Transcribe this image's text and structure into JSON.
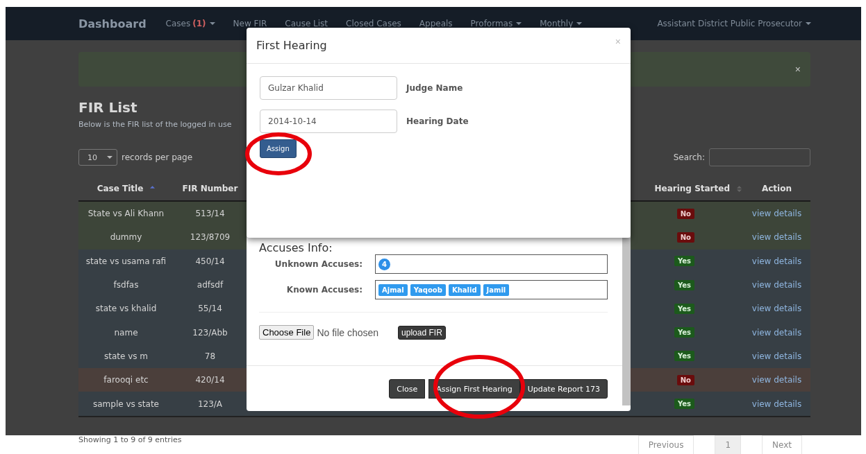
{
  "navbar": {
    "brand": "Dashboard",
    "items": [
      {
        "label": "Cases",
        "count": "(1)",
        "dropdown": true
      },
      {
        "label": "New FIR",
        "dropdown": false
      },
      {
        "label": "Cause List",
        "dropdown": false
      },
      {
        "label": "Closed Cases",
        "dropdown": false
      },
      {
        "label": "Appeals",
        "dropdown": false
      },
      {
        "label": "Proformas",
        "dropdown": true
      },
      {
        "label": "Monthly",
        "dropdown": true
      }
    ],
    "user": {
      "label": "Assistant District Public Prosecutor",
      "dropdown": true
    }
  },
  "alert": {
    "close": "×"
  },
  "page": {
    "title": "FIR List",
    "subtitle": "Below is the FIR list of the logged in use"
  },
  "length": {
    "value": "10",
    "label": "records per page"
  },
  "search": {
    "label": "Search:"
  },
  "table": {
    "columns": [
      {
        "label": "Case Title",
        "sorted": true
      },
      {
        "label": "FIR Number"
      },
      {
        "label": "Hearing Started",
        "sorted": false
      },
      {
        "label": "Action"
      }
    ],
    "rows": [
      {
        "kind": "success",
        "title": "State vs Ali Khann",
        "fir": "513/14",
        "started": false,
        "badge": "No",
        "action": "view details"
      },
      {
        "kind": "success",
        "title": "dummy",
        "fir": "123/8709",
        "started": false,
        "badge": "No",
        "action": "view details"
      },
      {
        "kind": "info",
        "title": "state vs usama rafi",
        "fir": "450/14",
        "started": true,
        "badge": "Yes",
        "action": "view details"
      },
      {
        "kind": "info",
        "title": "fsdfas",
        "fir": "adfsdf",
        "started": true,
        "badge": "Yes",
        "action": "view details"
      },
      {
        "kind": "info",
        "title": "state vs khalid",
        "fir": "55/14",
        "started": true,
        "badge": "Yes",
        "action": "view details"
      },
      {
        "kind": "info",
        "title": "name",
        "fir": "123/Abb",
        "started": true,
        "badge": "Yes",
        "action": "view details"
      },
      {
        "kind": "info",
        "title": "state vs m",
        "fir": "78",
        "started": true,
        "badge": "Yes",
        "action": "view details"
      },
      {
        "kind": "danger",
        "title": "farooqi etc",
        "fir": "420/14",
        "started": false,
        "badge": "No",
        "action": "view details"
      },
      {
        "kind": "info",
        "title": "sample vs state",
        "fir": "123/A",
        "started": true,
        "badge": "Yes",
        "action": "view details"
      }
    ]
  },
  "info": "Showing 1 to 9 of 9 entries",
  "pagination": [
    {
      "label": "Previous",
      "selected": false
    },
    {
      "label": "1",
      "selected": true
    },
    {
      "label": "Next",
      "selected": false
    }
  ],
  "back_modal": {
    "section": "Accuses Info:",
    "unknown_label": "Unknown Accuses:",
    "unknown_count": "4",
    "known_label": "Known Accuses:",
    "known": [
      "Ajmal",
      "Yaqoob",
      "Khalid",
      "Jamil"
    ],
    "file_button": "Choose File",
    "file_status": "No file chosen",
    "upload": "upload FIR",
    "buttons": [
      "Close",
      "Assign First Hearing",
      "Update Report 173"
    ]
  },
  "modal": {
    "title": "First Hearing",
    "close": "×",
    "fields": [
      {
        "value": "Gulzar Khalid",
        "label": "Judge Name"
      },
      {
        "value": "2014-10-14",
        "label": "Hearing Date"
      }
    ],
    "button": "Assign"
  }
}
